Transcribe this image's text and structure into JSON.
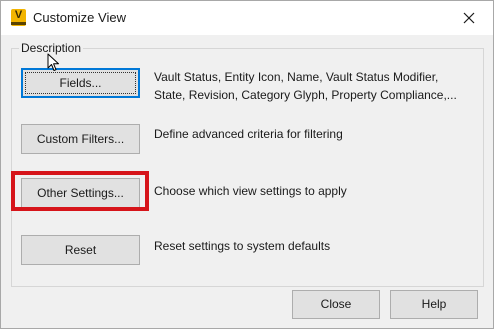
{
  "window": {
    "title": "Customize View",
    "app_icon_letter": "V"
  },
  "group": {
    "label": "Description"
  },
  "rows": [
    {
      "button": "Fields...",
      "description_line1": "Vault Status, Entity Icon, Name, Vault Status Modifier,",
      "description_line2": "State, Revision, Category Glyph, Property Compliance,..."
    },
    {
      "button": "Custom Filters...",
      "description": "Define advanced criteria for filtering"
    },
    {
      "button": "Other Settings...",
      "description": "Choose which view settings to apply"
    },
    {
      "button": "Reset",
      "description": "Reset settings to system defaults"
    }
  ],
  "footer": {
    "close_label": "Close",
    "help_label": "Help"
  },
  "colors": {
    "highlight": "#d6141a",
    "default_button_border": "#0078d7",
    "app_icon": "#f2b400"
  }
}
